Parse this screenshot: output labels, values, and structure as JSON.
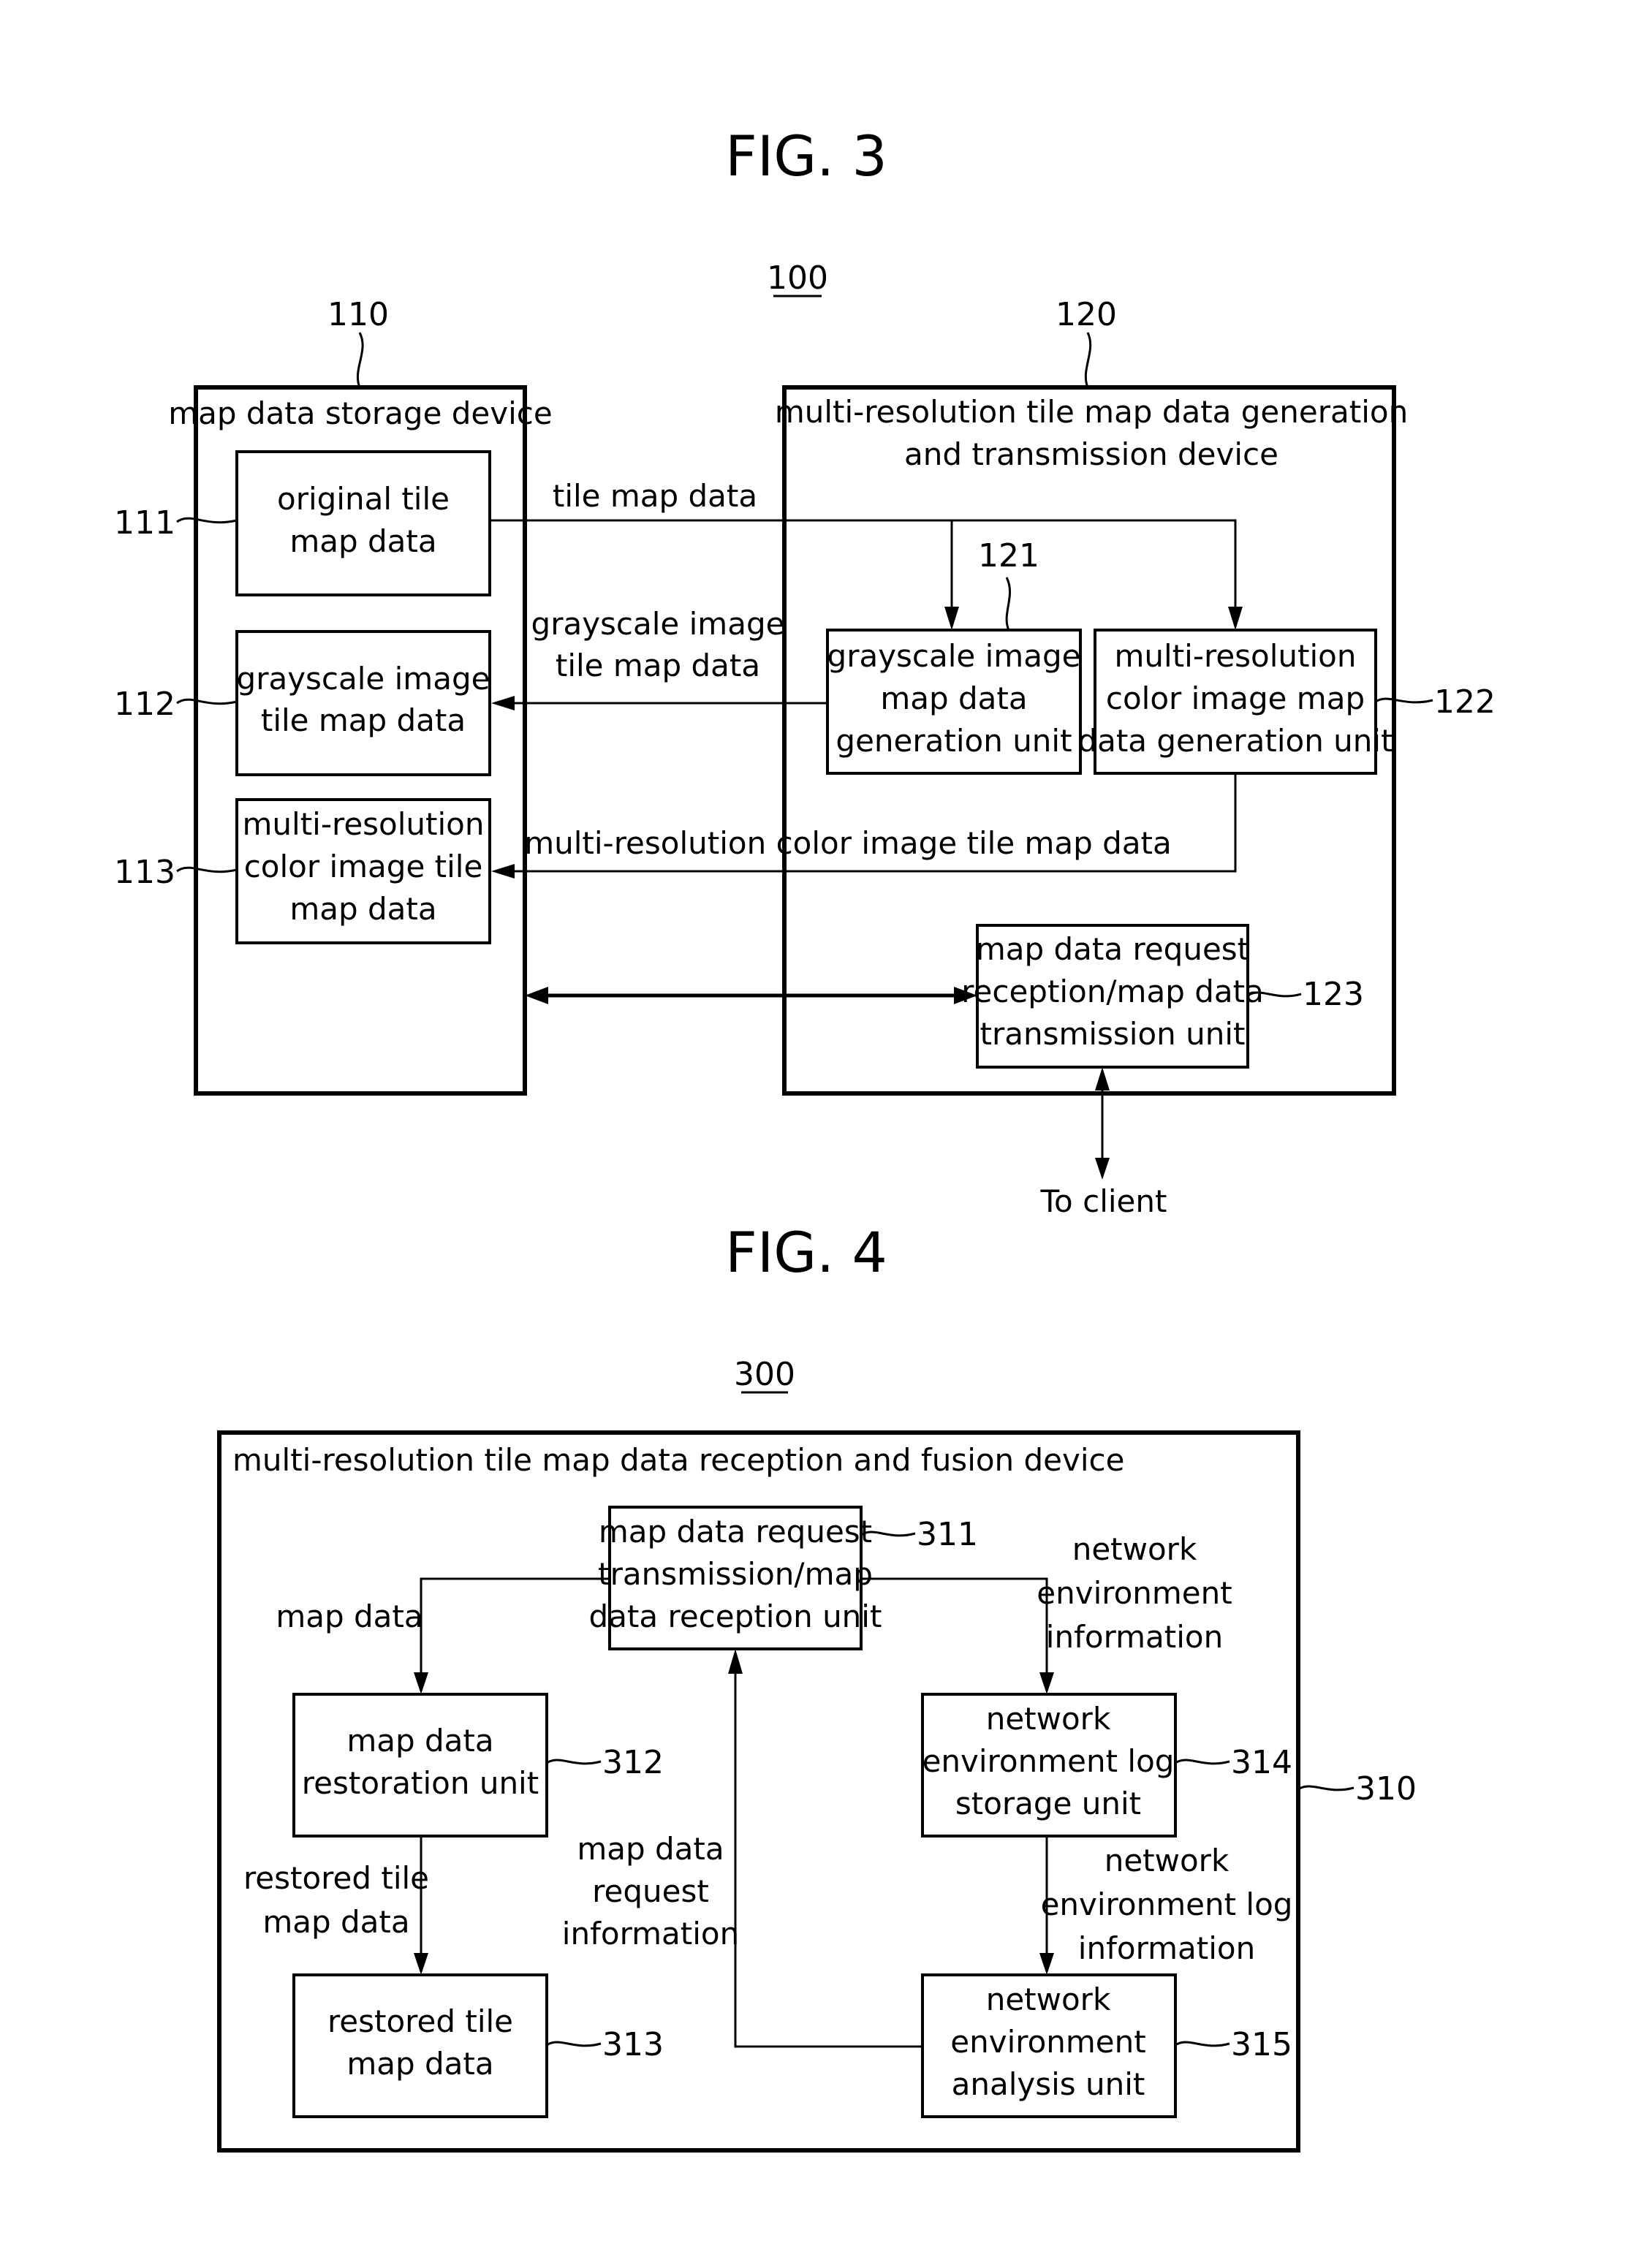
{
  "fig3": {
    "title": "FIG. 3",
    "system_ref": "100",
    "storage_device": {
      "ref": "110",
      "label": "map data storage device",
      "items": [
        {
          "ref": "111",
          "lines": [
            "original tile",
            "map data"
          ]
        },
        {
          "ref": "112",
          "lines": [
            "grayscale image",
            "tile map data"
          ]
        },
        {
          "ref": "113",
          "lines": [
            "multi-resolution",
            "color image tile",
            "map data"
          ]
        }
      ]
    },
    "generation_device": {
      "ref": "120",
      "label_lines": [
        "multi-resolution tile map data generation",
        "and transmission device"
      ],
      "units": [
        {
          "ref": "121",
          "lines": [
            "grayscale image",
            "map data",
            "generation unit"
          ]
        },
        {
          "ref": "122",
          "lines": [
            "multi-resolution",
            "color image map",
            "data generation unit"
          ]
        },
        {
          "ref": "123",
          "lines": [
            "map data request",
            "reception/map data",
            "transmission unit"
          ]
        }
      ]
    },
    "flows": {
      "tile_map_data": "tile map data",
      "grayscale": [
        "grayscale image",
        "tile map data"
      ],
      "color": "multi-resolution color image tile map data",
      "to_client": "To client"
    }
  },
  "fig4": {
    "title": "FIG. 4",
    "system_ref": "300",
    "device": {
      "ref": "310",
      "label": "multi-resolution tile map data reception and fusion device"
    },
    "units": [
      {
        "ref": "311",
        "lines": [
          "map data request",
          "transmission/map",
          "data reception unit"
        ]
      },
      {
        "ref": "312",
        "lines": [
          "map data",
          "restoration unit"
        ]
      },
      {
        "ref": "313",
        "lines": [
          "restored tile",
          "map data"
        ]
      },
      {
        "ref": "314",
        "lines": [
          "network",
          "environment log",
          "storage unit"
        ]
      },
      {
        "ref": "315",
        "lines": [
          "network",
          "environment",
          "analysis unit"
        ]
      }
    ],
    "flows": {
      "map_data": "map data",
      "restored": [
        "restored tile",
        "map data"
      ],
      "request_info": [
        "map data",
        "request",
        "information"
      ],
      "net_env_info": [
        "network",
        "environment",
        "information"
      ],
      "net_log_info": [
        "network",
        "environment log",
        "information"
      ]
    }
  }
}
